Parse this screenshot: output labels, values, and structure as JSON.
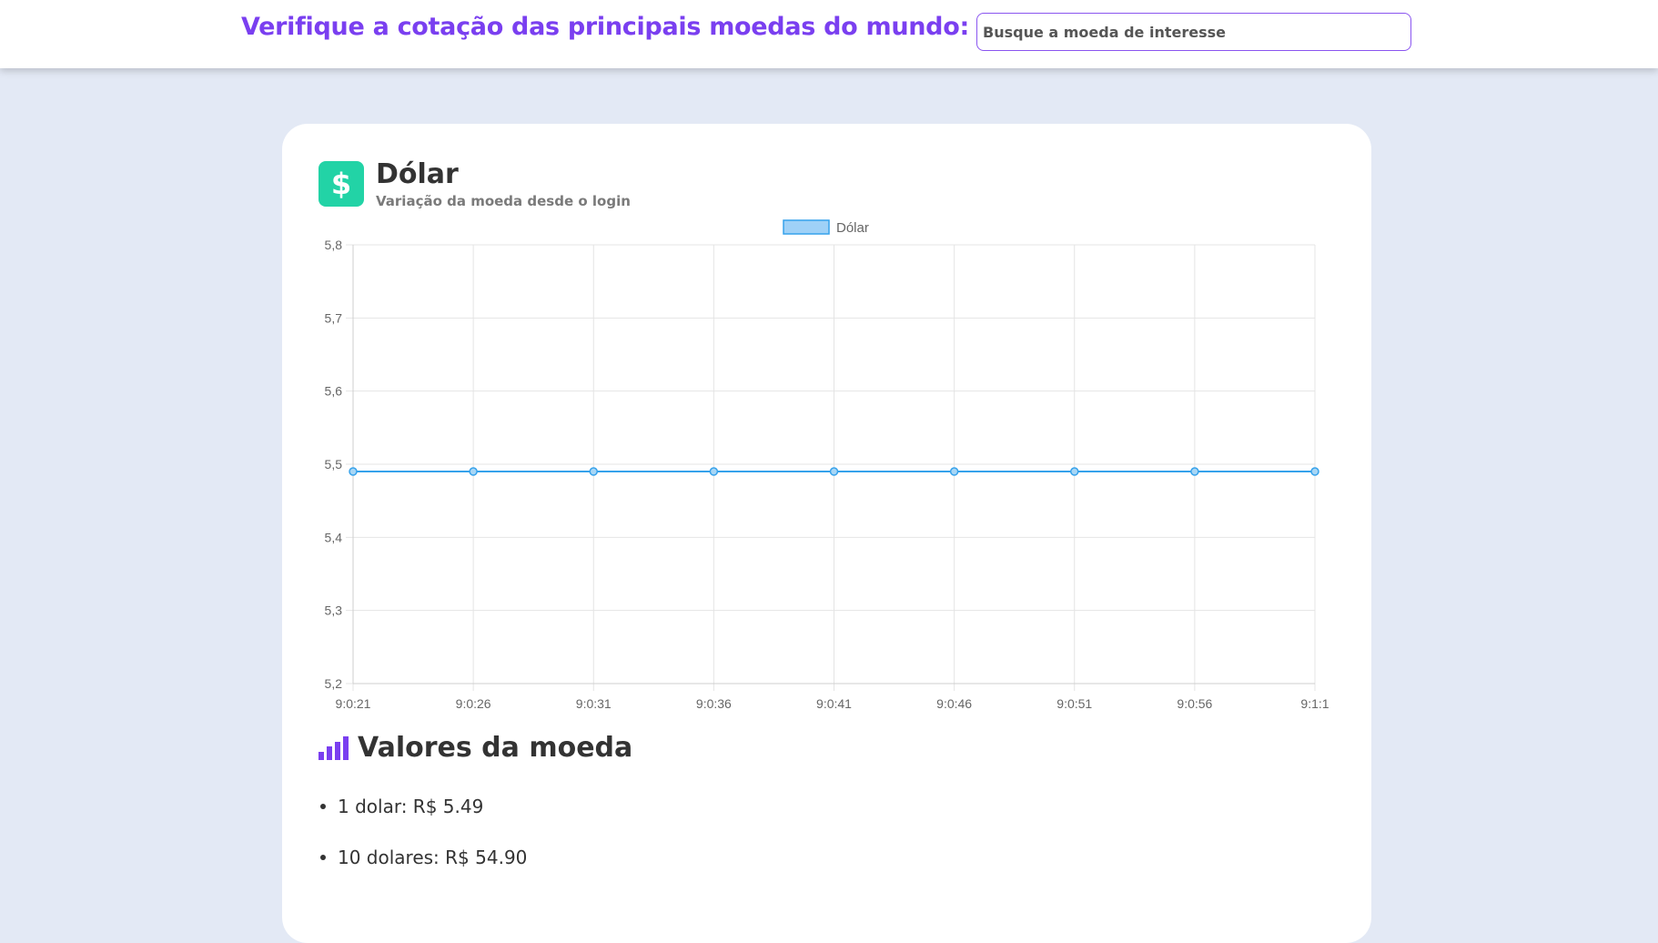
{
  "header": {
    "headline": "Verifique a cotação das principais moedas do mundo:",
    "search_placeholder": "Busque a moeda de interesse"
  },
  "coin": {
    "icon": "dollar-icon",
    "icon_glyph": "$",
    "title": "Dólar",
    "subtitle": "Variação da moeda desde o login",
    "accent_color": "#22d3a6"
  },
  "chart_data": {
    "type": "line",
    "x": [
      "9:0:21",
      "9:0:26",
      "9:0:31",
      "9:0:36",
      "9:0:41",
      "9:0:46",
      "9:0:51",
      "9:0:56",
      "9:1:1"
    ],
    "series": [
      {
        "name": "Dólar",
        "values": [
          5.49,
          5.49,
          5.49,
          5.49,
          5.49,
          5.49,
          5.49,
          5.49,
          5.49
        ],
        "color": "#36a2eb"
      }
    ],
    "y_ticks": [
      "5,8",
      "5,7",
      "5,6",
      "5,5",
      "5,4",
      "5,3",
      "5,2"
    ],
    "ylim": [
      5.2,
      5.8
    ],
    "grid": true,
    "legend": "top-center"
  },
  "values_section": {
    "title": "Valores da moeda",
    "icon": "bar-chart-icon",
    "items": [
      "1 dolar: R$ 5.49",
      "10 dolares: R$ 54.90"
    ]
  },
  "colors": {
    "brand": "#7a3ff0",
    "background": "#e3e9f5"
  }
}
